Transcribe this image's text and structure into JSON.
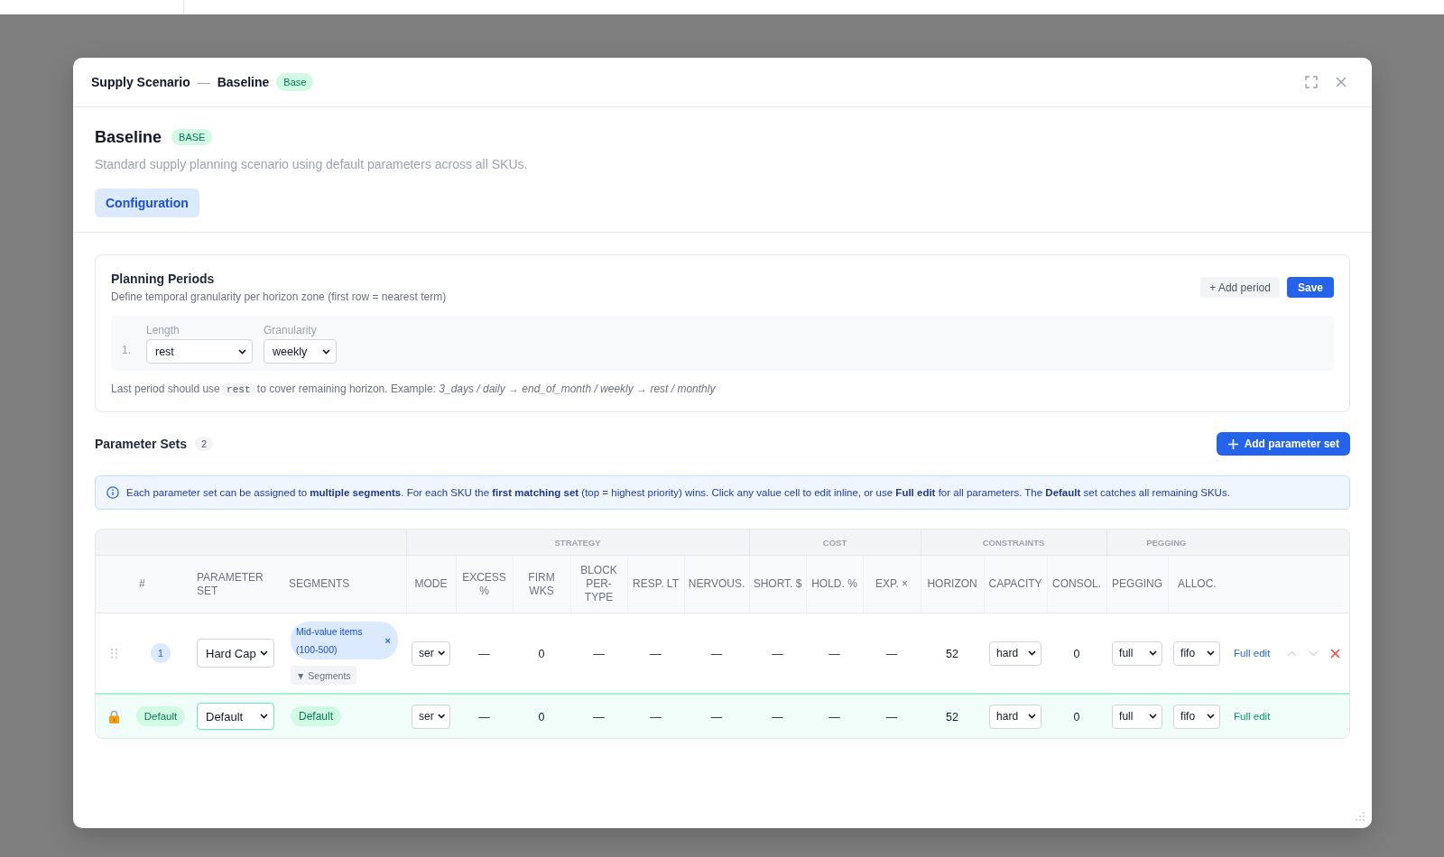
{
  "window": {
    "title": "Supply Scenario",
    "separator": "—",
    "subtitle": "Baseline",
    "badge": "Base"
  },
  "scenario": {
    "name": "Baseline",
    "badge": "BASE",
    "description": "Standard supply planning scenario using default parameters across all SKUs.",
    "tabs": [
      {
        "label": "Configuration",
        "selected": true
      }
    ]
  },
  "planning_periods": {
    "title": "Planning Periods",
    "subtitle": "Define temporal granularity per horizon zone (first row = nearest term)",
    "add_button": "+ Add period",
    "save_button": "Save",
    "periods": [
      {
        "index": "1.",
        "length_label": "Length",
        "length": "rest",
        "granularity_label": "Granularity",
        "granularity": "weekly"
      }
    ],
    "hint": {
      "before": "Last period should use",
      "code": "rest",
      "after": "to cover remaining horizon. Example: *3_days / daily → end_of_month / weekly → rest / monthly*"
    }
  },
  "parameter_sets": {
    "title": "Parameter Sets",
    "count": "2",
    "add_button": "Add parameter set",
    "info": "Each parameter set can be assigned to **multiple segments**. For each SKU the **first matching set** (top = highest priority) wins. Click any value cell to edit inline, or use **Full edit** for all parameters. The **Default** set catches all remaining SKUs.",
    "column_groups": [
      {
        "columns": [
          "#",
          "PARAMETER SET",
          "SEGMENTS"
        ]
      },
      {
        "label": "STRATEGY",
        "columns": [
          "MODE",
          "EXCESS %",
          "FIRM WKS",
          "BLOCK PER-TYPE",
          "RESP. LT",
          "NERVOUS."
        ]
      },
      {
        "label": "COST",
        "columns": [
          "SHORT. $",
          "HOLD. %",
          "EXP. ×"
        ]
      },
      {
        "label": "CONSTRAINTS",
        "columns": [
          "HORIZON",
          "CAPACITY",
          "CONSOL."
        ]
      },
      {
        "label": "PEGGING",
        "columns": [
          "PEGGING",
          "ALLOC."
        ]
      }
    ],
    "rows": [
      {
        "kind": "custom",
        "locked": false,
        "rank": "1",
        "parameter_set": "Hard Cap",
        "segments": [
          {
            "label": "Mid-value items (100-500)",
            "remove": "×"
          }
        ],
        "segments_button": "▼ Segments",
        "values": [
          {
            "kind": "select",
            "text": "ser"
          },
          {
            "kind": "text",
            "text": "—"
          },
          {
            "kind": "text",
            "text": "0"
          },
          {
            "kind": "text",
            "text": "—"
          },
          {
            "kind": "text",
            "text": "—"
          },
          {
            "kind": "text",
            "text": "—"
          },
          {
            "kind": "text",
            "text": "—"
          },
          {
            "kind": "text",
            "text": "—"
          },
          {
            "kind": "text",
            "text": "—"
          },
          {
            "kind": "text",
            "text": "52"
          },
          {
            "kind": "select",
            "text": "hard"
          },
          {
            "kind": "text",
            "text": "0"
          },
          {
            "kind": "select",
            "text": "full"
          },
          {
            "kind": "select",
            "text": "fifo"
          }
        ],
        "edit_link": "Full edit",
        "reorderable": true,
        "move_up_disabled": true,
        "move_down_disabled": true,
        "deletable": true
      },
      {
        "kind": "default",
        "locked": true,
        "rank": "Default",
        "parameter_set": "Default",
        "segments": [
          {
            "label": "Default"
          }
        ],
        "values": [
          {
            "kind": "select",
            "text": "ser"
          },
          {
            "kind": "text",
            "text": "—"
          },
          {
            "kind": "text",
            "text": "0"
          },
          {
            "kind": "text",
            "text": "—"
          },
          {
            "kind": "text",
            "text": "—"
          },
          {
            "kind": "text",
            "text": "—"
          },
          {
            "kind": "text",
            "text": "—"
          },
          {
            "kind": "text",
            "text": "—"
          },
          {
            "kind": "text",
            "text": "—"
          },
          {
            "kind": "text",
            "text": "52"
          },
          {
            "kind": "select",
            "text": "hard"
          },
          {
            "kind": "text",
            "text": "0"
          },
          {
            "kind": "select",
            "text": "full"
          },
          {
            "kind": "select",
            "text": "fifo"
          }
        ],
        "edit_link": "Full edit",
        "reorderable": false,
        "deletable": false
      }
    ]
  }
}
